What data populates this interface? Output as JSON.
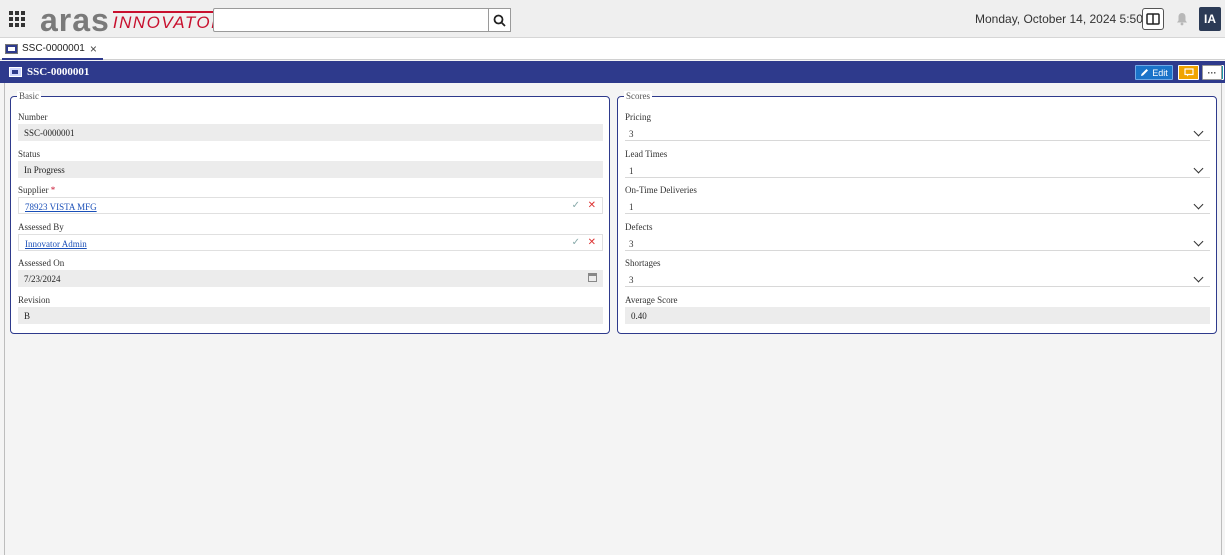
{
  "app": {
    "logo_main": "aras",
    "logo_sub": "INNOVATOR",
    "datetime": "Monday, October 14, 2024 5:50 AM",
    "avatar_initials": "IA",
    "search_value": ""
  },
  "tabs": [
    {
      "label": "SSC-0000001",
      "close": "×"
    }
  ],
  "item": {
    "title": "SSC-0000001",
    "edit_label": "Edit",
    "more_label": "···"
  },
  "basic": {
    "legend": "Basic",
    "fields": {
      "number": {
        "label": "Number",
        "value": "SSC-0000001"
      },
      "status": {
        "label": "Status",
        "value": "In Progress"
      },
      "supplier": {
        "label": "Supplier",
        "required": "*",
        "value": "78923 VISTA MFG"
      },
      "assessed_by": {
        "label": "Assessed By",
        "value": "Innovator Admin"
      },
      "assessed_on": {
        "label": "Assessed On",
        "value": "7/23/2024"
      },
      "revision": {
        "label": "Revision",
        "value": "B"
      }
    }
  },
  "scores": {
    "legend": "Scores",
    "fields": {
      "pricing": {
        "label": "Pricing",
        "value": "3"
      },
      "lead_times": {
        "label": "Lead Times",
        "value": "1"
      },
      "on_time": {
        "label": "On-Time Deliveries",
        "value": "1"
      },
      "defects": {
        "label": "Defects",
        "value": "3"
      },
      "shortages": {
        "label": "Shortages",
        "value": "3"
      },
      "average": {
        "label": "Average Score",
        "value": "0.40"
      }
    }
  },
  "colors": {
    "header_blue": "#2e3a8c",
    "brand_red": "#c8102e",
    "edit_blue": "#1a73c9",
    "orange": "#f0a400",
    "teal": "#1c9aa8"
  },
  "icons": [
    "apps-grid-icon",
    "search-icon",
    "layout-icon",
    "bell-icon",
    "item-type-icon",
    "pencil-icon",
    "comment-icon",
    "refresh-icon",
    "checkmark-icon",
    "clear-icon",
    "calendar-icon",
    "chevron-down-icon"
  ]
}
